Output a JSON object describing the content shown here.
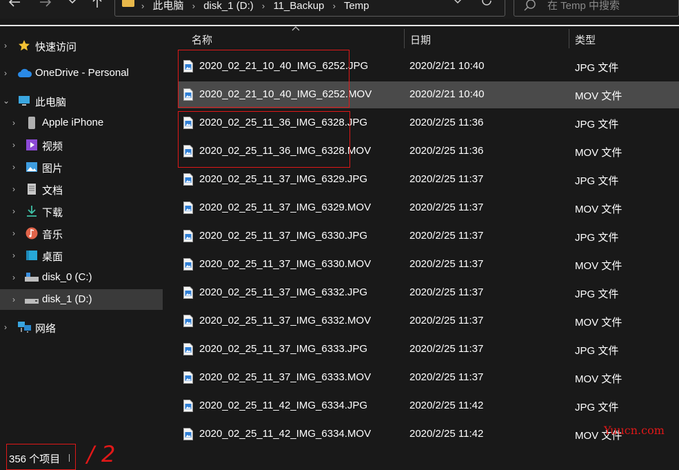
{
  "addressbar": {
    "crumbs": [
      "此电脑",
      "disk_1 (D:)",
      "11_Backup",
      "Temp"
    ]
  },
  "search": {
    "placeholder": "在 Temp 中搜索"
  },
  "sidebar": {
    "items": [
      {
        "label": "快速访问",
        "icon": "star-icon",
        "level": 0,
        "expanded": false
      },
      {
        "label": "OneDrive - Personal",
        "icon": "cloud-icon",
        "level": 0,
        "expanded": false
      },
      {
        "label": "此电脑",
        "icon": "computer-icon",
        "level": 0,
        "expanded": true
      },
      {
        "label": "Apple iPhone",
        "icon": "phone-icon",
        "level": 1,
        "expanded": false
      },
      {
        "label": "视频",
        "icon": "video-icon",
        "level": 1,
        "expanded": false
      },
      {
        "label": "图片",
        "icon": "pictures-icon",
        "level": 1,
        "expanded": false
      },
      {
        "label": "文档",
        "icon": "document-icon",
        "level": 1,
        "expanded": false
      },
      {
        "label": "下载",
        "icon": "download-icon",
        "level": 1,
        "expanded": false
      },
      {
        "label": "音乐",
        "icon": "music-icon",
        "level": 1,
        "expanded": false
      },
      {
        "label": "桌面",
        "icon": "desktop-icon",
        "level": 1,
        "expanded": false
      },
      {
        "label": "disk_0 (C:)",
        "icon": "drive-icon",
        "level": 1,
        "expanded": false
      },
      {
        "label": "disk_1 (D:)",
        "icon": "drive-icon",
        "level": 1,
        "expanded": false,
        "selected": true
      },
      {
        "label": "网络",
        "icon": "network-icon",
        "level": 0,
        "expanded": false
      }
    ]
  },
  "columns": {
    "name": "名称",
    "date": "日期",
    "type": "类型"
  },
  "files": [
    {
      "name": "2020_02_21_10_40_IMG_6252.JPG",
      "date": "2020/2/21 10:40",
      "type": "JPG 文件"
    },
    {
      "name": "2020_02_21_10_40_IMG_6252.MOV",
      "date": "2020/2/21 10:40",
      "type": "MOV 文件",
      "selected": true
    },
    {
      "name": "2020_02_25_11_36_IMG_6328.JPG",
      "date": "2020/2/25 11:36",
      "type": "JPG 文件"
    },
    {
      "name": "2020_02_25_11_36_IMG_6328.MOV",
      "date": "2020/2/25 11:36",
      "type": "MOV 文件"
    },
    {
      "name": "2020_02_25_11_37_IMG_6329.JPG",
      "date": "2020/2/25 11:37",
      "type": "JPG 文件"
    },
    {
      "name": "2020_02_25_11_37_IMG_6329.MOV",
      "date": "2020/2/25 11:37",
      "type": "MOV 文件"
    },
    {
      "name": "2020_02_25_11_37_IMG_6330.JPG",
      "date": "2020/2/25 11:37",
      "type": "JPG 文件"
    },
    {
      "name": "2020_02_25_11_37_IMG_6330.MOV",
      "date": "2020/2/25 11:37",
      "type": "MOV 文件"
    },
    {
      "name": "2020_02_25_11_37_IMG_6332.JPG",
      "date": "2020/2/25 11:37",
      "type": "JPG 文件"
    },
    {
      "name": "2020_02_25_11_37_IMG_6332.MOV",
      "date": "2020/2/25 11:37",
      "type": "MOV 文件"
    },
    {
      "name": "2020_02_25_11_37_IMG_6333.JPG",
      "date": "2020/2/25 11:37",
      "type": "JPG 文件"
    },
    {
      "name": "2020_02_25_11_37_IMG_6333.MOV",
      "date": "2020/2/25 11:37",
      "type": "MOV 文件"
    },
    {
      "name": "2020_02_25_11_42_IMG_6334.JPG",
      "date": "2020/2/25 11:42",
      "type": "JPG 文件"
    },
    {
      "name": "2020_02_25_11_42_IMG_6334.MOV",
      "date": "2020/2/25 11:42",
      "type": "MOV 文件"
    }
  ],
  "status": {
    "count": "356 个项目"
  },
  "annotation": {
    "text": "/ 2"
  },
  "watermark": {
    "text": "Yuucn.com"
  },
  "colors": {
    "highlight": "#e01818",
    "background": "#191919",
    "selection": "#4a4a4a"
  }
}
